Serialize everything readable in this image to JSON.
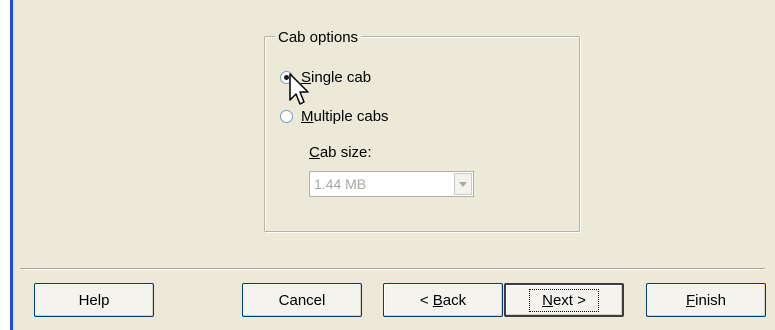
{
  "group": {
    "title": "Cab options"
  },
  "options": {
    "single_cab": {
      "label_accel": "S",
      "label_rest": "ingle cab",
      "selected": true
    },
    "multiple_cabs": {
      "label_accel": "M",
      "label_rest": "ultiple cabs",
      "selected": false
    }
  },
  "cab_size": {
    "label_accel": "C",
    "label_rest": "ab size:",
    "value": "1.44 MB",
    "enabled": false
  },
  "buttons": {
    "help": "Help",
    "cancel": "Cancel",
    "back_prefix": "< ",
    "back_accel": "B",
    "back_rest": "ack",
    "next_accel": "N",
    "next_rest": "ext >",
    "finish_accel": "F",
    "finish_rest": "inish"
  },
  "icons": {
    "cursor": "mouse-pointer-icon",
    "dropdown": "chevron-down-icon"
  },
  "colors": {
    "panel_background": "#ece9d8",
    "accent_border": "#1f4fd6",
    "disabled_text": "#a9a6a0"
  }
}
